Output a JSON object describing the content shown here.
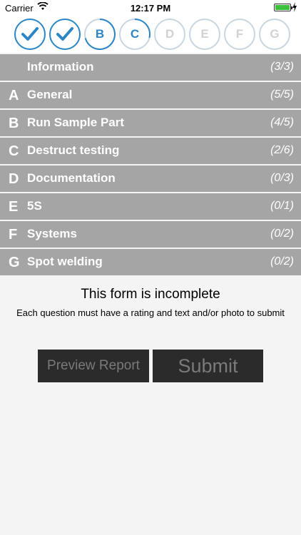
{
  "status_bar": {
    "carrier": "Carrier",
    "time": "12:17 PM",
    "wifi_icon": "wifi-icon",
    "battery_icon": "battery-icon"
  },
  "steps": [
    {
      "label": "",
      "state": "done",
      "icon": "checkmark-icon"
    },
    {
      "label": "",
      "state": "done",
      "icon": "checkmark-icon"
    },
    {
      "label": "B",
      "state": "partial"
    },
    {
      "label": "C",
      "state": "partial"
    },
    {
      "label": "D",
      "state": "empty"
    },
    {
      "label": "E",
      "state": "empty"
    },
    {
      "label": "F",
      "state": "empty"
    },
    {
      "label": "G",
      "state": "empty"
    }
  ],
  "sections": [
    {
      "letter": "",
      "title": "Information",
      "count": "(3/3)"
    },
    {
      "letter": "A",
      "title": "General",
      "count": "(5/5)"
    },
    {
      "letter": "B",
      "title": "Run Sample Part",
      "count": "(4/5)"
    },
    {
      "letter": "C",
      "title": "Destruct testing",
      "count": "(2/6)"
    },
    {
      "letter": "D",
      "title": "Documentation",
      "count": "(0/3)"
    },
    {
      "letter": "E",
      "title": "5S",
      "count": "(0/1)"
    },
    {
      "letter": "F",
      "title": "Systems",
      "count": "(0/2)"
    },
    {
      "letter": "G",
      "title": "Spot welding",
      "count": "(0/2)"
    }
  ],
  "message": {
    "title": "This form is incomplete",
    "subtitle": "Each question must have a rating and text and/or photo to submit"
  },
  "buttons": {
    "preview": "Preview Report",
    "submit": "Submit"
  },
  "colors": {
    "accent": "#2a86c4",
    "row_bg": "#a5a5a5",
    "button_bg": "#2b2b2b",
    "battery": "#3cc13c"
  }
}
